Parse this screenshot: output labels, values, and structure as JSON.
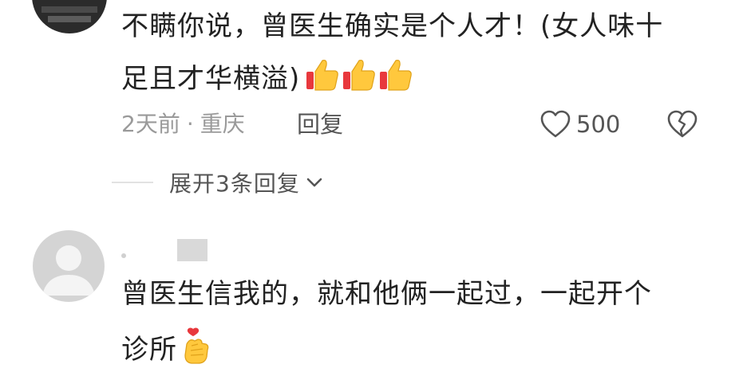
{
  "comment1": {
    "text_line1": "不瞒你说，曾医生确实是个人才！(女人味十",
    "text_line2": "足且才华横溢)",
    "emoji_count": 3,
    "time": "2天前",
    "separator": "·",
    "location": "重庆",
    "reply_label": "回复",
    "like_count": "500"
  },
  "expand": {
    "label": "展开3条回复"
  },
  "comment2": {
    "text_line1": "曾医生信我的，就和他俩一起过，一起开个",
    "text_line2": "诊所"
  },
  "colors": {
    "text": "#222222",
    "meta": "#9a9a9a",
    "action": "#555555",
    "thumb_yellow": "#ffc83d",
    "thumb_red": "#e8383d"
  }
}
